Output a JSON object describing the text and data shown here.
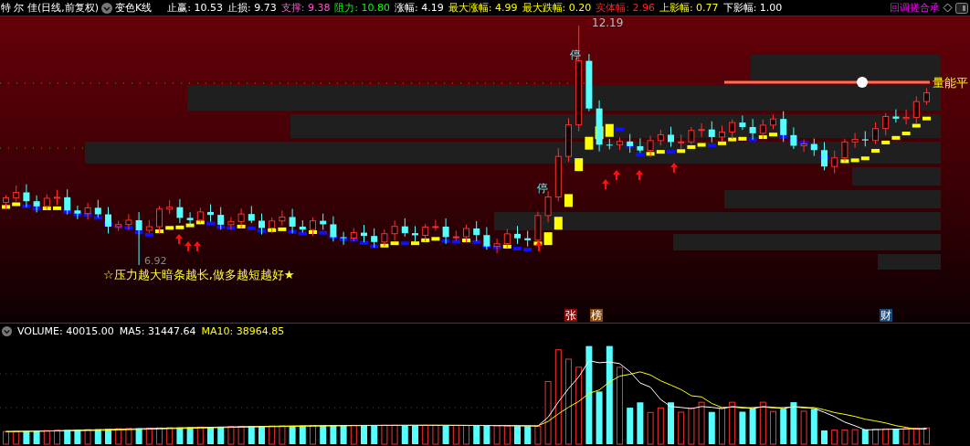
{
  "chart_header": {
    "title": "特 尔 佳(日线,前复权)",
    "indicator": "变色K线",
    "stats": [
      {
        "text": "止赢: 10.53",
        "color": "#ffffff"
      },
      {
        "text": "止损: 9.73",
        "color": "#ffffff"
      },
      {
        "text": "支撑: 9.38",
        "color": "#ff55cc"
      },
      {
        "text": "阻力: 10.80",
        "color": "#00ff00"
      },
      {
        "text": "涨幅: 4.19",
        "color": "#ffffff"
      },
      {
        "text": "最大涨幅: 4.99",
        "color": "#ffff00"
      },
      {
        "text": "最大跌幅: 0.20",
        "color": "#ffff00"
      },
      {
        "text": "实体幅: 2.96",
        "color": "#ff2020"
      },
      {
        "text": "上影幅: 0.77",
        "color": "#ffff00"
      },
      {
        "text": "下影幅: 1.00",
        "color": "#ffffff"
      }
    ],
    "right_label": "回调搓合承"
  },
  "price_chart": {
    "high_label": "12.19",
    "low_label": "6.92",
    "limit_marks": [
      "停",
      "停"
    ],
    "platform_label": "量能平",
    "caption": "☆压力越大暗条越长,做多越短越好★",
    "event_tags": [
      {
        "text": "张",
        "color": "#8b0a0a"
      },
      {
        "text": "榜",
        "color": "#8b4a10"
      },
      {
        "text": "财",
        "color": "#1c4a78"
      }
    ]
  },
  "volume_panel": {
    "stats": [
      {
        "text": "VOLUME: 40015.00",
        "color": "#ffffff"
      },
      {
        "text": "MA5: 31447.64",
        "color": "#ffffff"
      },
      {
        "text": "MA10: 38964.85",
        "color": "#ffff00"
      }
    ]
  }
}
